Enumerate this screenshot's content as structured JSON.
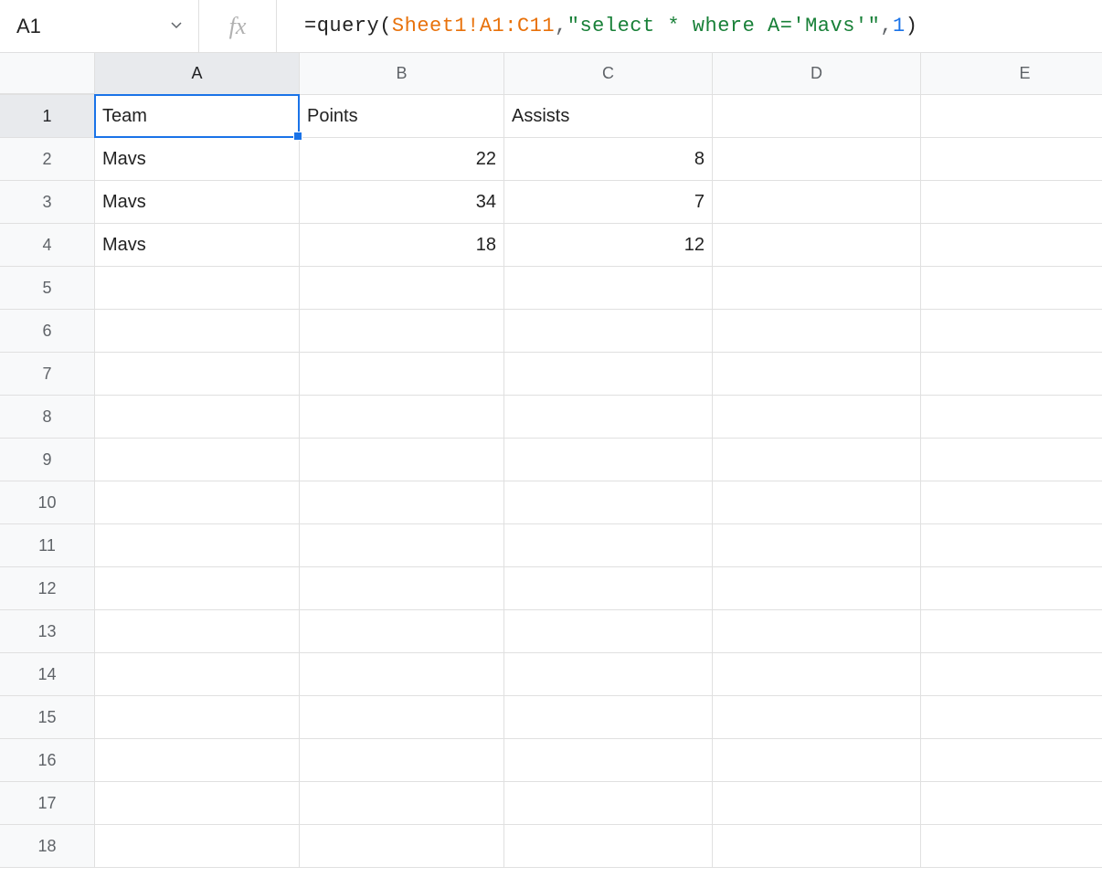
{
  "nameBox": "A1",
  "fxLabel": "fx",
  "formula": {
    "parts": [
      {
        "t": "=query",
        "c": "f-black"
      },
      {
        "t": "(",
        "c": "f-black"
      },
      {
        "t": "Sheet1!A1:C11",
        "c": "f-orange"
      },
      {
        "t": ",",
        "c": "f-gray"
      },
      {
        "t": " ",
        "c": "f-black"
      },
      {
        "t": "\"select * where A='Mavs'\"",
        "c": "f-green"
      },
      {
        "t": ",",
        "c": "f-gray"
      },
      {
        "t": " ",
        "c": "f-black"
      },
      {
        "t": "1",
        "c": "f-blue"
      },
      {
        "t": ")",
        "c": "f-black"
      }
    ]
  },
  "columns": [
    "A",
    "B",
    "C",
    "D",
    "E"
  ],
  "rowCount": 18,
  "selectedCell": {
    "row": 1,
    "col": "A"
  },
  "data": {
    "1": {
      "A": {
        "v": "Team",
        "t": "text"
      },
      "B": {
        "v": "Points",
        "t": "text"
      },
      "C": {
        "v": "Assists",
        "t": "text"
      }
    },
    "2": {
      "A": {
        "v": "Mavs",
        "t": "text"
      },
      "B": {
        "v": "22",
        "t": "num"
      },
      "C": {
        "v": "8",
        "t": "num"
      }
    },
    "3": {
      "A": {
        "v": "Mavs",
        "t": "text"
      },
      "B": {
        "v": "34",
        "t": "num"
      },
      "C": {
        "v": "7",
        "t": "num"
      }
    },
    "4": {
      "A": {
        "v": "Mavs",
        "t": "text"
      },
      "B": {
        "v": "18",
        "t": "num"
      },
      "C": {
        "v": "12",
        "t": "num"
      }
    }
  }
}
